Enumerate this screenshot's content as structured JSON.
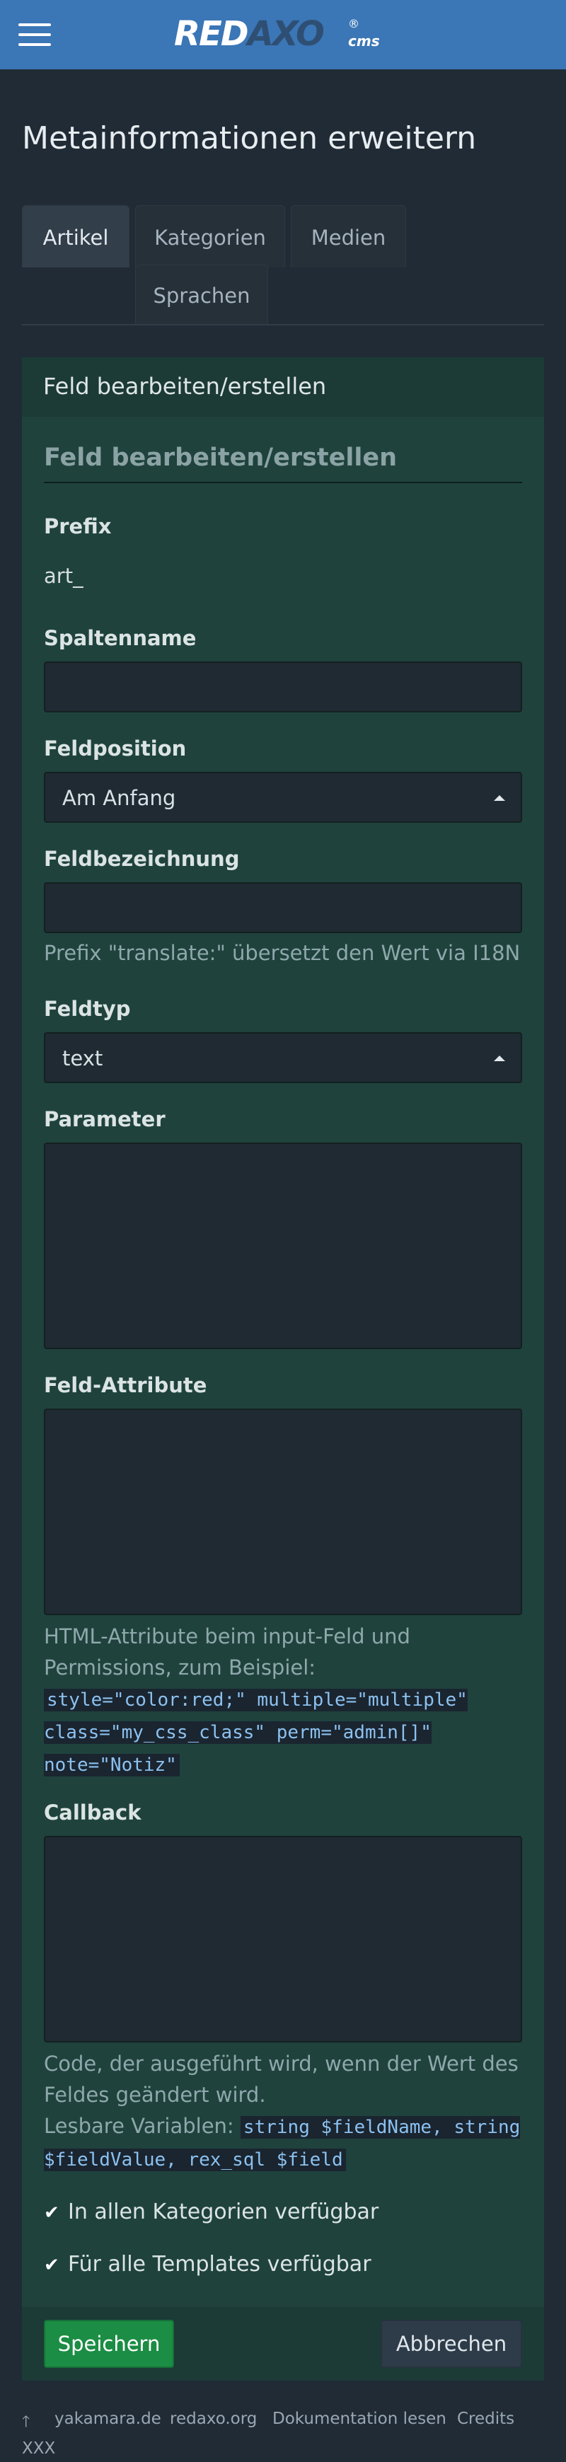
{
  "header": {
    "menu_icon": "hamburger-menu-icon",
    "logo_part1": "RED",
    "logo_part2": "AXO",
    "logo_reg": "®",
    "logo_suffix": "cms",
    "brand_color": "#3b76b6"
  },
  "page": {
    "title": "Metainformationen erweitern"
  },
  "tabs": [
    {
      "label": "Artikel",
      "active": true
    },
    {
      "label": "Kategorien",
      "active": false
    },
    {
      "label": "Medien",
      "active": false
    },
    {
      "label": "Sprachen",
      "active": false
    }
  ],
  "panel": {
    "heading": "Feld bearbeiten/erstellen",
    "legend": "Feld bearbeiten/erstellen",
    "prefix_label": "Prefix",
    "prefix_value": "art_",
    "column_label": "Spaltenname",
    "column_value": "",
    "position_label": "Feldposition",
    "position_value": "Am Anfang",
    "title_label": "Feldbezeichnung",
    "title_value": "",
    "title_help": "Prefix \"translate:\" übersetzt den Wert via I18N",
    "type_label": "Feldtyp",
    "type_value": "text",
    "params_label": "Parameter",
    "params_value": "",
    "attributes_label": "Feld-Attribute",
    "attributes_value": "",
    "attributes_help_text": "HTML-Attribute beim input-Feld und Permissions, zum Beispiel:",
    "attributes_help_code": "style=\"color:red;\" multiple=\"multiple\" class=\"my_css_class\" perm=\"admin[]\" note=\"Notiz\"",
    "callback_label": "Callback",
    "callback_value": "",
    "callback_help_text": "Code, der ausgeführt wird, wenn der Wert des Feldes geändert wird.",
    "callback_vars_label": "Lesbare Variablen:",
    "callback_vars_code": "string $fieldName, string $fieldValue, rex_sql $field",
    "check_categories": "In allen Kategorien verfügbar",
    "check_templates": "Für alle Templates verfügbar",
    "save_label": "Speichern",
    "cancel_label": "Abbrechen",
    "save_color": "#1b8d44"
  },
  "footer": {
    "up_icon": "arrow-up-icon",
    "links": [
      "yakamara.de",
      "redaxo.org",
      "Dokumentation lesen",
      "Credits"
    ],
    "extra": "XXX"
  }
}
